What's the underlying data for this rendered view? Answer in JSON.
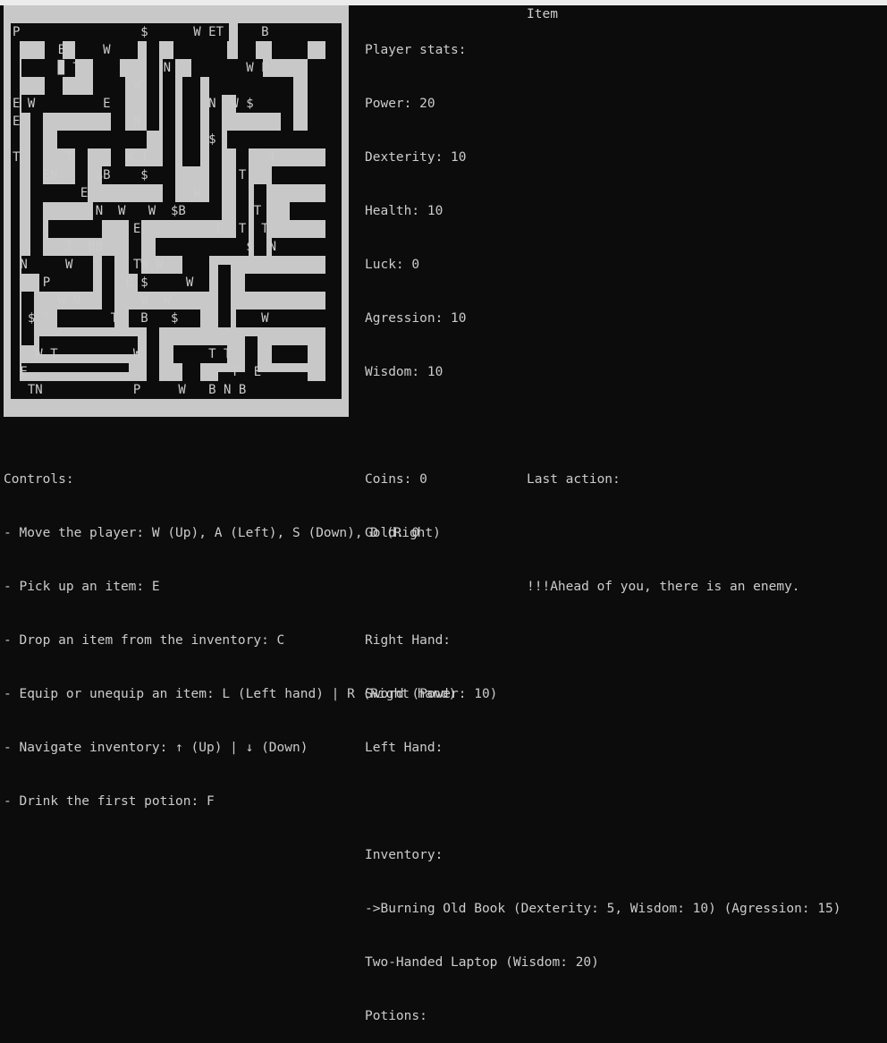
{
  "maze": {
    "rows": [
      "P                $      W ET     B",
      "      E     W",
      "      ▉ T           N          W P",
      "                W",
      "E W         E             N  W $",
      "E               N",
      "                          $",
      "T      T       W T                T",
      "    EN     $B    $            T",
      "         E              W",
      "           N  W   W  $B         T",
      "                E          E  T  T",
      "       T  BB                   $  N",
      " N     W        TW W",
      "    P          B $     W",
      "      W N        W  W",
      "  $ T        T   B   $           W",
      "",
      "   W T          W         T T",
      " E                           T  E",
      "  TN            P     W   B N B"
    ]
  },
  "stats": {
    "header": "Player stats:",
    "item_header": "Item",
    "power": "Power: 20",
    "dexterity": "Dexterity: 10",
    "health": "Health: 10",
    "luck": "Luck: 0",
    "agression": "Agression: 10",
    "wisdom": "Wisdom: 10",
    "coins": "Coins: 0",
    "gold": "Gold: 0",
    "right_hand_label": "Right Hand:",
    "right_hand_item": "Sword (Power: 10)",
    "left_hand_label": "Left Hand:",
    "inventory_label": "Inventory:",
    "inventory_items": [
      "->Burning Old Book (Dexterity: 5, Wisdom: 10) (Agression: 15)",
      "Two-Handed Laptop (Wisdom: 20)"
    ],
    "potions_label": "Potions:"
  },
  "controls": {
    "title": "Controls:",
    "lines": [
      "- Move the player: W (Up), A (Left), S (Down), D (Right)",
      "- Pick up an item: E",
      "- Drop an item from the inventory: C",
      "- Equip or unequip an item: L (Left hand) | R (Right hand)",
      "- Navigate inventory: ↑ (Up) | ↓ (Down)",
      "- Drink the first potion: F"
    ]
  },
  "last_action": {
    "title": "Last action:",
    "message": "!!!Ahead of you, there is an enemy."
  },
  "colors": {
    "background": "#0c0c0c",
    "wall": "#c8c8c8",
    "text": "#cccccc"
  }
}
